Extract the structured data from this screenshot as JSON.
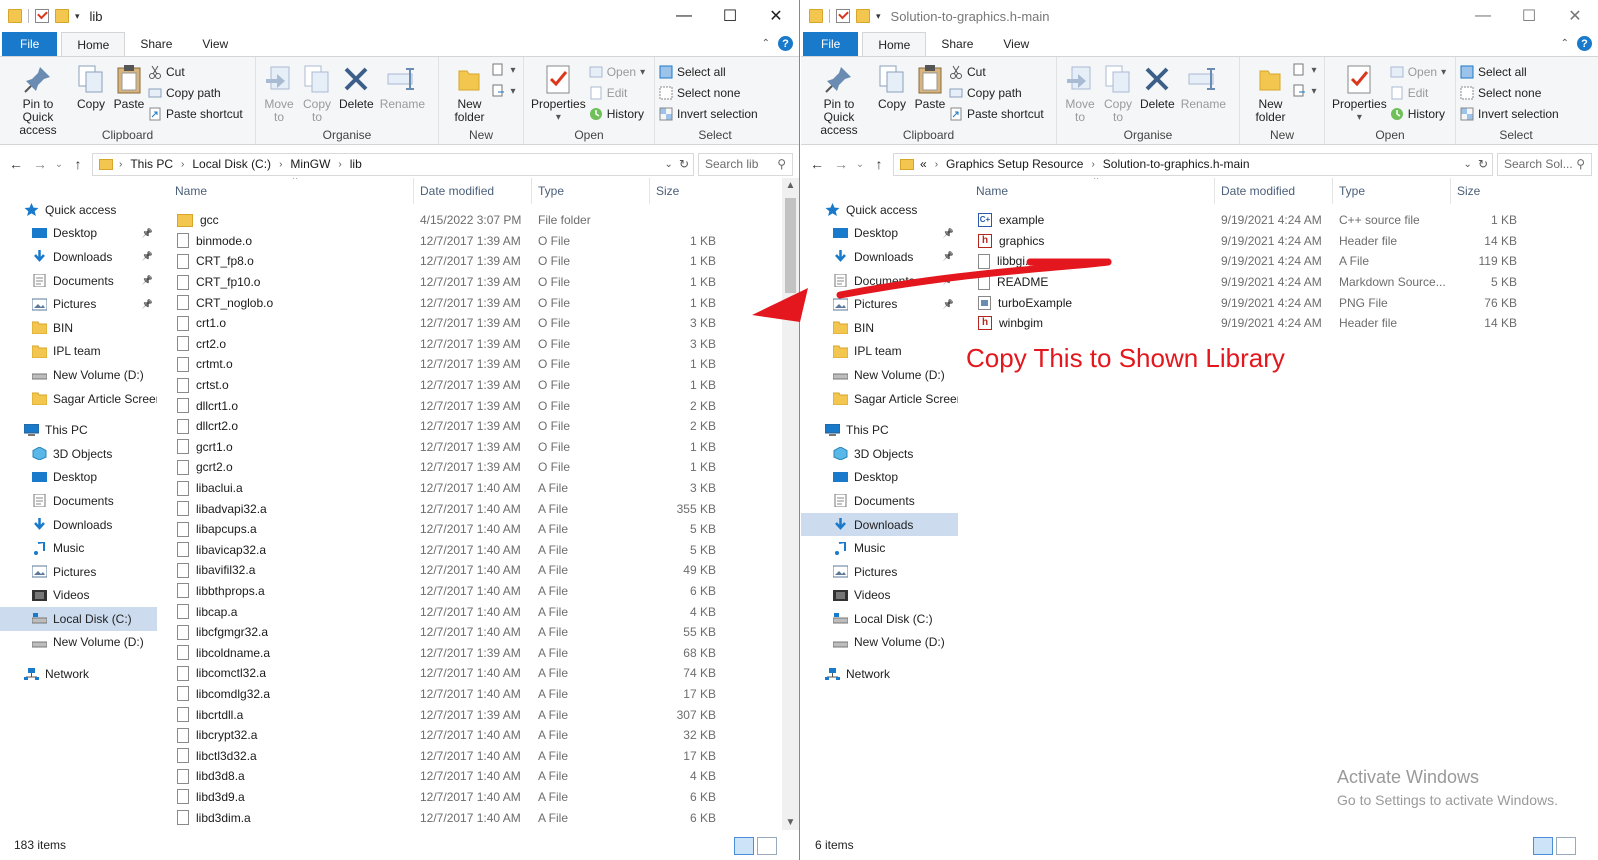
{
  "annotation_text": "Copy This to Shown Library",
  "left": {
    "title": "lib",
    "tabs": [
      "File",
      "Home",
      "Share",
      "View"
    ],
    "ribbon": {
      "clipboard": {
        "pin": "Pin to Quick access",
        "copy": "Copy",
        "paste": "Paste",
        "cut": "Cut",
        "copy_path": "Copy path",
        "paste_shortcut": "Paste shortcut",
        "label": "Clipboard"
      },
      "organise": {
        "move_to": "Move to",
        "copy_to": "Copy to",
        "delete": "Delete",
        "rename": "Rename",
        "label": "Organise"
      },
      "new": {
        "new_folder": "New folder",
        "label": "New"
      },
      "open": {
        "properties": "Properties",
        "open": "Open",
        "edit": "Edit",
        "history": "History",
        "label": "Open"
      },
      "select": {
        "select_all": "Select all",
        "select_none": "Select none",
        "invert": "Invert selection",
        "label": "Select"
      }
    },
    "address": [
      "This PC",
      "Local Disk (C:)",
      "MinGW",
      "lib"
    ],
    "search_placeholder": "Search lib",
    "nav": [
      {
        "label": "Quick access",
        "icon": "star-icon",
        "top": true
      },
      {
        "label": "Desktop",
        "icon": "desktop-icon",
        "pin": true
      },
      {
        "label": "Downloads",
        "icon": "download-icon",
        "pin": true
      },
      {
        "label": "Documents",
        "icon": "documents-icon",
        "pin": true
      },
      {
        "label": "Pictures",
        "icon": "pictures-icon",
        "pin": true
      },
      {
        "label": "BIN",
        "icon": "folder-icon"
      },
      {
        "label": "IPL team",
        "icon": "folder-icon"
      },
      {
        "label": "New Volume (D:)",
        "icon": "drive-icon"
      },
      {
        "label": "Sagar Article Screen",
        "icon": "folder-icon"
      },
      {
        "label": "This PC",
        "icon": "pc-icon",
        "top": true,
        "gap": true
      },
      {
        "label": "3D Objects",
        "icon": "cube-icon"
      },
      {
        "label": "Desktop",
        "icon": "desktop-icon"
      },
      {
        "label": "Documents",
        "icon": "documents-icon"
      },
      {
        "label": "Downloads",
        "icon": "download-icon"
      },
      {
        "label": "Music",
        "icon": "music-icon"
      },
      {
        "label": "Pictures",
        "icon": "pictures-icon"
      },
      {
        "label": "Videos",
        "icon": "videos-icon"
      },
      {
        "label": "Local Disk (C:)",
        "icon": "os-drive-icon",
        "sel": true
      },
      {
        "label": "New Volume (D:)",
        "icon": "drive-icon"
      },
      {
        "label": "Network",
        "icon": "network-icon",
        "top": true,
        "gap": true
      }
    ],
    "columns": [
      "Name",
      "Date modified",
      "Type",
      "Size"
    ],
    "files": [
      {
        "name": "gcc",
        "date": "4/15/2022 3:07 PM",
        "type": "File folder",
        "size": "",
        "folder": true
      },
      {
        "name": "binmode.o",
        "date": "12/7/2017 1:39 AM",
        "type": "O File",
        "size": "1 KB"
      },
      {
        "name": "CRT_fp8.o",
        "date": "12/7/2017 1:39 AM",
        "type": "O File",
        "size": "1 KB"
      },
      {
        "name": "CRT_fp10.o",
        "date": "12/7/2017 1:39 AM",
        "type": "O File",
        "size": "1 KB"
      },
      {
        "name": "CRT_noglob.o",
        "date": "12/7/2017 1:39 AM",
        "type": "O File",
        "size": "1 KB"
      },
      {
        "name": "crt1.o",
        "date": "12/7/2017 1:39 AM",
        "type": "O File",
        "size": "3 KB"
      },
      {
        "name": "crt2.o",
        "date": "12/7/2017 1:39 AM",
        "type": "O File",
        "size": "3 KB"
      },
      {
        "name": "crtmt.o",
        "date": "12/7/2017 1:39 AM",
        "type": "O File",
        "size": "1 KB"
      },
      {
        "name": "crtst.o",
        "date": "12/7/2017 1:39 AM",
        "type": "O File",
        "size": "1 KB"
      },
      {
        "name": "dllcrt1.o",
        "date": "12/7/2017 1:39 AM",
        "type": "O File",
        "size": "2 KB"
      },
      {
        "name": "dllcrt2.o",
        "date": "12/7/2017 1:39 AM",
        "type": "O File",
        "size": "2 KB"
      },
      {
        "name": "gcrt1.o",
        "date": "12/7/2017 1:39 AM",
        "type": "O File",
        "size": "1 KB"
      },
      {
        "name": "gcrt2.o",
        "date": "12/7/2017 1:39 AM",
        "type": "O File",
        "size": "1 KB"
      },
      {
        "name": "libaclui.a",
        "date": "12/7/2017 1:40 AM",
        "type": "A File",
        "size": "3 KB"
      },
      {
        "name": "libadvapi32.a",
        "date": "12/7/2017 1:40 AM",
        "type": "A File",
        "size": "355 KB"
      },
      {
        "name": "libapcups.a",
        "date": "12/7/2017 1:40 AM",
        "type": "A File",
        "size": "5 KB"
      },
      {
        "name": "libavicap32.a",
        "date": "12/7/2017 1:40 AM",
        "type": "A File",
        "size": "5 KB"
      },
      {
        "name": "libavifil32.a",
        "date": "12/7/2017 1:40 AM",
        "type": "A File",
        "size": "49 KB"
      },
      {
        "name": "libbthprops.a",
        "date": "12/7/2017 1:40 AM",
        "type": "A File",
        "size": "6 KB"
      },
      {
        "name": "libcap.a",
        "date": "12/7/2017 1:40 AM",
        "type": "A File",
        "size": "4 KB"
      },
      {
        "name": "libcfgmgr32.a",
        "date": "12/7/2017 1:40 AM",
        "type": "A File",
        "size": "55 KB"
      },
      {
        "name": "libcoldname.a",
        "date": "12/7/2017 1:39 AM",
        "type": "A File",
        "size": "68 KB"
      },
      {
        "name": "libcomctl32.a",
        "date": "12/7/2017 1:40 AM",
        "type": "A File",
        "size": "74 KB"
      },
      {
        "name": "libcomdlg32.a",
        "date": "12/7/2017 1:40 AM",
        "type": "A File",
        "size": "17 KB"
      },
      {
        "name": "libcrtdll.a",
        "date": "12/7/2017 1:39 AM",
        "type": "A File",
        "size": "307 KB"
      },
      {
        "name": "libcrypt32.a",
        "date": "12/7/2017 1:40 AM",
        "type": "A File",
        "size": "32 KB"
      },
      {
        "name": "libctl3d32.a",
        "date": "12/7/2017 1:40 AM",
        "type": "A File",
        "size": "17 KB"
      },
      {
        "name": "libd3d8.a",
        "date": "12/7/2017 1:40 AM",
        "type": "A File",
        "size": "4 KB"
      },
      {
        "name": "libd3d9.a",
        "date": "12/7/2017 1:40 AM",
        "type": "A File",
        "size": "6 KB"
      },
      {
        "name": "libd3dim.a",
        "date": "12/7/2017 1:40 AM",
        "type": "A File",
        "size": "6 KB"
      }
    ],
    "status": "183 items"
  },
  "right": {
    "title": "Solution-to-graphics.h-main",
    "tabs": [
      "File",
      "Home",
      "Share",
      "View"
    ],
    "address": [
      "«",
      "Graphics Setup Resource",
      "Solution-to-graphics.h-main"
    ],
    "search_placeholder": "Search Sol...",
    "nav": [
      {
        "label": "Quick access",
        "icon": "star-icon",
        "top": true
      },
      {
        "label": "Desktop",
        "icon": "desktop-icon",
        "pin": true
      },
      {
        "label": "Downloads",
        "icon": "download-icon",
        "pin": true
      },
      {
        "label": "Documents",
        "icon": "documents-icon",
        "pin": true
      },
      {
        "label": "Pictures",
        "icon": "pictures-icon",
        "pin": true
      },
      {
        "label": "BIN",
        "icon": "folder-icon"
      },
      {
        "label": "IPL team",
        "icon": "folder-icon"
      },
      {
        "label": "New Volume (D:)",
        "icon": "drive-icon"
      },
      {
        "label": "Sagar Article Screen",
        "icon": "folder-icon"
      },
      {
        "label": "This PC",
        "icon": "pc-icon",
        "top": true,
        "gap": true
      },
      {
        "label": "3D Objects",
        "icon": "cube-icon"
      },
      {
        "label": "Desktop",
        "icon": "desktop-icon"
      },
      {
        "label": "Documents",
        "icon": "documents-icon"
      },
      {
        "label": "Downloads",
        "icon": "download-icon",
        "sel": true
      },
      {
        "label": "Music",
        "icon": "music-icon"
      },
      {
        "label": "Pictures",
        "icon": "pictures-icon"
      },
      {
        "label": "Videos",
        "icon": "videos-icon"
      },
      {
        "label": "Local Disk (C:)",
        "icon": "os-drive-icon"
      },
      {
        "label": "New Volume (D:)",
        "icon": "drive-icon"
      },
      {
        "label": "Network",
        "icon": "network-icon",
        "top": true,
        "gap": true
      }
    ],
    "columns": [
      "Name",
      "Date modified",
      "Type",
      "Size"
    ],
    "files": [
      {
        "name": "example",
        "date": "9/19/2021 4:24 AM",
        "type": "C++ source file",
        "size": "1 KB",
        "icon": "cpp"
      },
      {
        "name": "graphics",
        "date": "9/19/2021 4:24 AM",
        "type": "Header file",
        "size": "14 KB",
        "icon": "h"
      },
      {
        "name": "libbgi.a",
        "date": "9/19/2021 4:24 AM",
        "type": "A File",
        "size": "119 KB",
        "icon": "file"
      },
      {
        "name": "README",
        "date": "9/19/2021 4:24 AM",
        "type": "Markdown Source...",
        "size": "5 KB",
        "icon": "file"
      },
      {
        "name": "turboExample",
        "date": "9/19/2021 4:24 AM",
        "type": "PNG File",
        "size": "76 KB",
        "icon": "png"
      },
      {
        "name": "winbgim",
        "date": "9/19/2021 4:24 AM",
        "type": "Header file",
        "size": "14 KB",
        "icon": "h"
      }
    ],
    "status": "6 items",
    "watermark": {
      "title": "Activate Windows",
      "sub": "Go to Settings to activate Windows."
    }
  }
}
